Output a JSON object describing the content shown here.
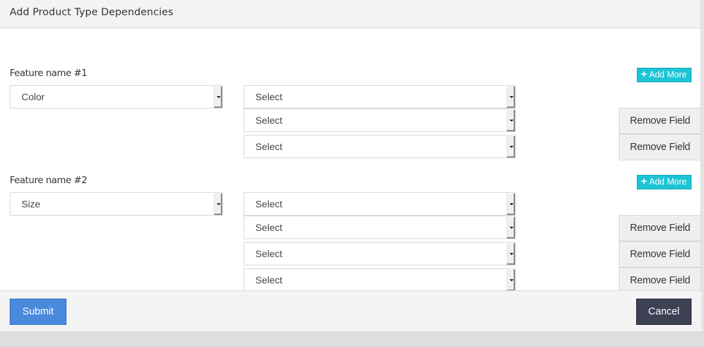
{
  "header": {
    "title": "Add Product Type Dependencies"
  },
  "features": [
    {
      "label": "Feature name #1",
      "value": "Color",
      "add_more_label": "Add More",
      "dependencies": [
        {
          "value": "Select",
          "remove_label": null
        },
        {
          "value": "Select",
          "remove_label": "Remove Field"
        },
        {
          "value": "Select",
          "remove_label": "Remove Field"
        }
      ]
    },
    {
      "label": "Feature name #2",
      "value": "Size",
      "add_more_label": "Add More",
      "dependencies": [
        {
          "value": "Select",
          "remove_label": null
        },
        {
          "value": "Select",
          "remove_label": "Remove Field"
        },
        {
          "value": "Select",
          "remove_label": "Remove Field"
        },
        {
          "value": "Select",
          "remove_label": "Remove Field"
        }
      ]
    }
  ],
  "icons": {
    "add": "plus-icon",
    "dropdown": "caret-down-icon"
  },
  "footer": {
    "submit_label": "Submit",
    "cancel_label": "Cancel"
  },
  "colors": {
    "add_more": "#1cc4d6",
    "submit": "#4a89dc",
    "cancel": "#3d4154"
  }
}
